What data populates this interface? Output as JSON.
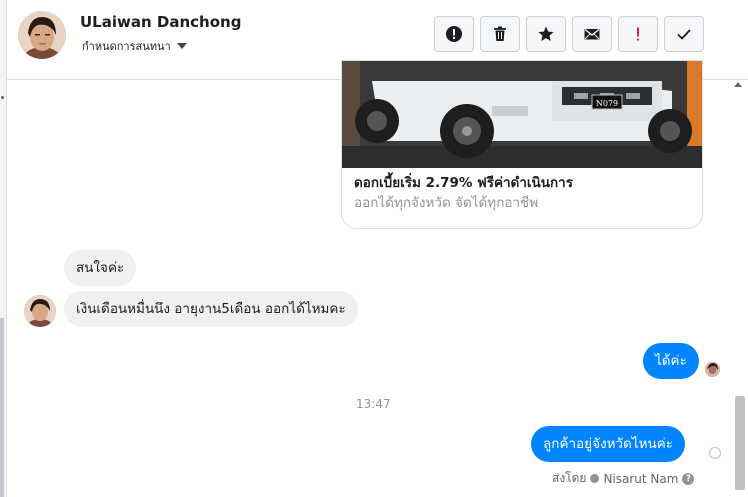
{
  "header": {
    "contact_name": "ULaiwan Danchong",
    "assign_label": "กำหนดการสนทนา",
    "tools": [
      {
        "name": "alert-circle-icon"
      },
      {
        "name": "trash-icon"
      },
      {
        "name": "star-icon"
      },
      {
        "name": "envelope-icon"
      },
      {
        "name": "exclamation-icon",
        "color": "#e41e3f"
      },
      {
        "name": "checkmark-icon"
      }
    ]
  },
  "ad_card": {
    "title": "ดอกเบี้ยเริ่ม 2.79% ฟรีค่าดำเนินการ",
    "subtitle": "ออกได้ทุกจังหวัด จัดได้ทุกอาชีพ",
    "plate": "N079"
  },
  "messages": [
    {
      "side": "in",
      "text": "สนใจค่ะ"
    },
    {
      "side": "in",
      "text": "เงินเดือนหมื่นนึง อายุงาน5เดือน ออกได้ไหมคะ"
    },
    {
      "side": "out",
      "text": "ได้ค่ะ"
    },
    {
      "side": "out",
      "text": "ลูกค้าอยู่จังหวัดไหนค่ะ"
    }
  ],
  "timestamp": "13:47",
  "sent_by": {
    "label": "ส่งโดย",
    "agent": "Nisarut Nam"
  },
  "colors": {
    "outgoing": "#0084ff",
    "incoming": "#f1f0f0",
    "alert": "#e41e3f"
  }
}
